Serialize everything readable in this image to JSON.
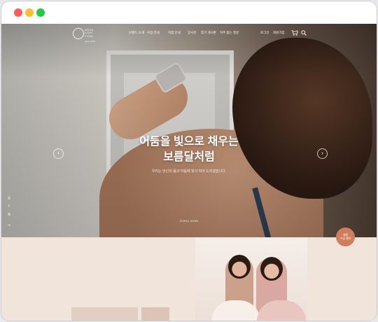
{
  "window": {
    "controls": [
      "close",
      "minimize",
      "maximize"
    ]
  },
  "logo": {
    "line1": "MOON",
    "line2": "LIGHT",
    "line3": "YOGA",
    "sub": "yoga studio"
  },
  "nav": {
    "items": [
      "브랜드 소개",
      "수업 안내",
      "지점 안내",
      "강사진",
      "후기 게시판",
      "자주 묻는 질문"
    ]
  },
  "utility": {
    "login": "로그인",
    "join": "회원가입"
  },
  "hero": {
    "headline_line1": "어둠을 빛으로 채우는",
    "headline_line2": "보름달처럼",
    "subtext": "우리는 당신의 몸과 마음에 빛이 되어 드리겠습니다.",
    "prev": "‹",
    "next": "›",
    "scroll_label": "SCROLL DOWN"
  },
  "social": {
    "icons": [
      "instagram-icon",
      "facebook-icon",
      "blog-icon",
      "share-icon"
    ],
    "glyphs": [
      "◎",
      "f",
      "B",
      "⋖"
    ]
  },
  "badge": {
    "line1": "체험",
    "line2": "수업 예약"
  },
  "colors": {
    "accent": "#cf7d5a",
    "lower_bg": "#f1e4da"
  }
}
